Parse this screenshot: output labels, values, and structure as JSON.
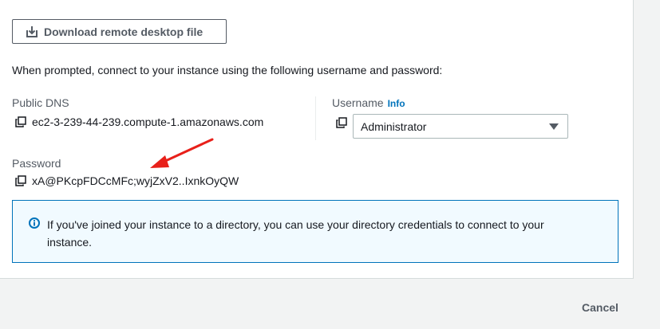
{
  "download_button": {
    "label": "Download remote desktop file",
    "icon": "download-icon"
  },
  "prompt_text": "When prompted, connect to your instance using the following username and password:",
  "public_dns": {
    "label": "Public DNS",
    "value": "ec2-3-239-44-239.compute-1.amazonaws.com",
    "icon": "copy-icon"
  },
  "username": {
    "label": "Username",
    "info_link": "Info",
    "selected": "Administrator",
    "icon": "copy-icon"
  },
  "password": {
    "label": "Password",
    "value": "xA@PKcpFDCcMFc;wyjZxV2..IxnkOyQW",
    "icon": "copy-icon"
  },
  "info_alert": {
    "text": "If you've joined your instance to a directory, you can use your directory credentials to connect to your instance.",
    "icon": "info-icon"
  },
  "footer": {
    "cancel_label": "Cancel"
  },
  "colors": {
    "accent": "#0073bb",
    "alert_bg": "#f1faff",
    "annotation_arrow": "#e8201a"
  }
}
